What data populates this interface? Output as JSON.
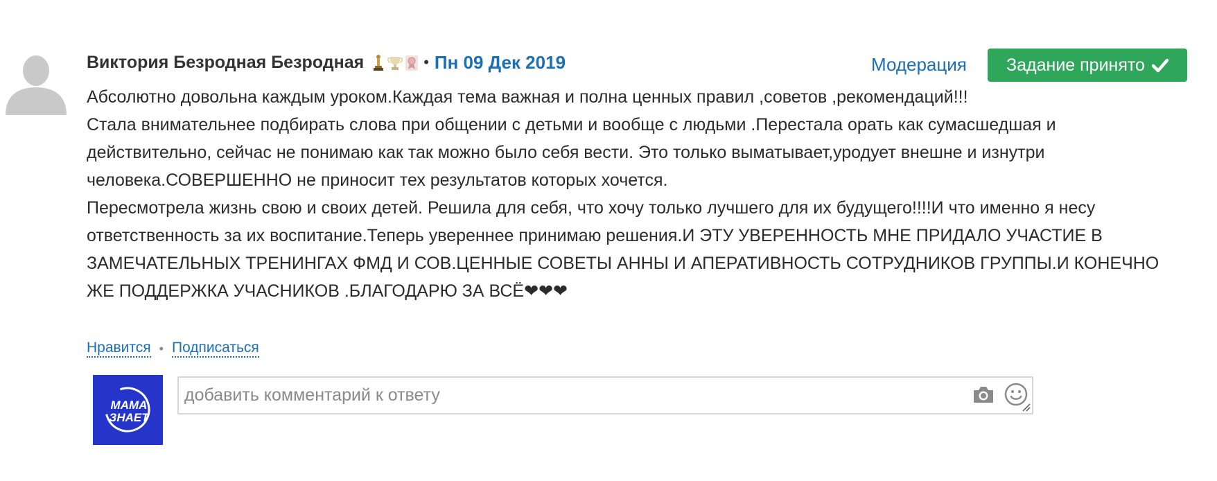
{
  "review": {
    "author": "Виктория Безродная Безродная",
    "separator": "•",
    "date": "Пн 09 Дек 2019",
    "moderation_label": "Модерация",
    "status_button_label": "Задание принято",
    "badges": [
      "statuette-badge",
      "cup-badge",
      "medal-badge"
    ],
    "paragraphs": [
      "Абсолютно довольна каждым уроком.Каждая тема важная и полна ценных правил ,советов ,рекомендаций!!!",
      "Стала внимательнее подбирать слова при общении с детьми и вообще с людьми .Перестала орать как сумасшедшая и действительно, сейчас не понимаю как так можно было себя вести. Это только выматывает,уродует внешне и изнутри человека.СОВЕРШЕННО не приносит тех результатов которых хочется.",
      "Пересмотрела жизнь свою и своих детей. Решила для себя, что хочу только лучшего для их будущего!!!!И что именно я несу ответственность за их воспитание.Теперь увереннее принимаю решения.И ЭТУ УВЕРЕННОСТЬ МНЕ ПРИДАЛО УЧАСТИЕ В ЗАМЕЧАТЕЛЬНЫХ ТРЕНИНГАХ ФМД И СОВ.ЦЕННЫЕ СОВЕТЫ АННЫ И АПЕРАТИВНОСТЬ СОТРУДНИКОВ ГРУППЫ.И КОНЕЧНО ЖЕ ПОДДЕРЖКА УЧАСНИКОВ .БЛАГОДАРЮ ЗА ВСЁ❤❤❤"
    ]
  },
  "actions": {
    "like_label": "Нравится",
    "separator": "•",
    "subscribe_label": "Подписаться"
  },
  "comment": {
    "logo_text_line1": "МАМА",
    "logo_text_line2": "ЗНАЕТ",
    "placeholder": "добавить комментарий к ответу"
  },
  "colors": {
    "link": "#1a6fb5",
    "accept_button": "#2ea75a",
    "logo_bg": "#2535c9",
    "text": "#2b2b2b"
  },
  "icons": {
    "avatar": "user-silhouette-icon",
    "status_button": "check-icon",
    "comment_photo": "camera-icon",
    "comment_emoji": "smile-icon"
  }
}
